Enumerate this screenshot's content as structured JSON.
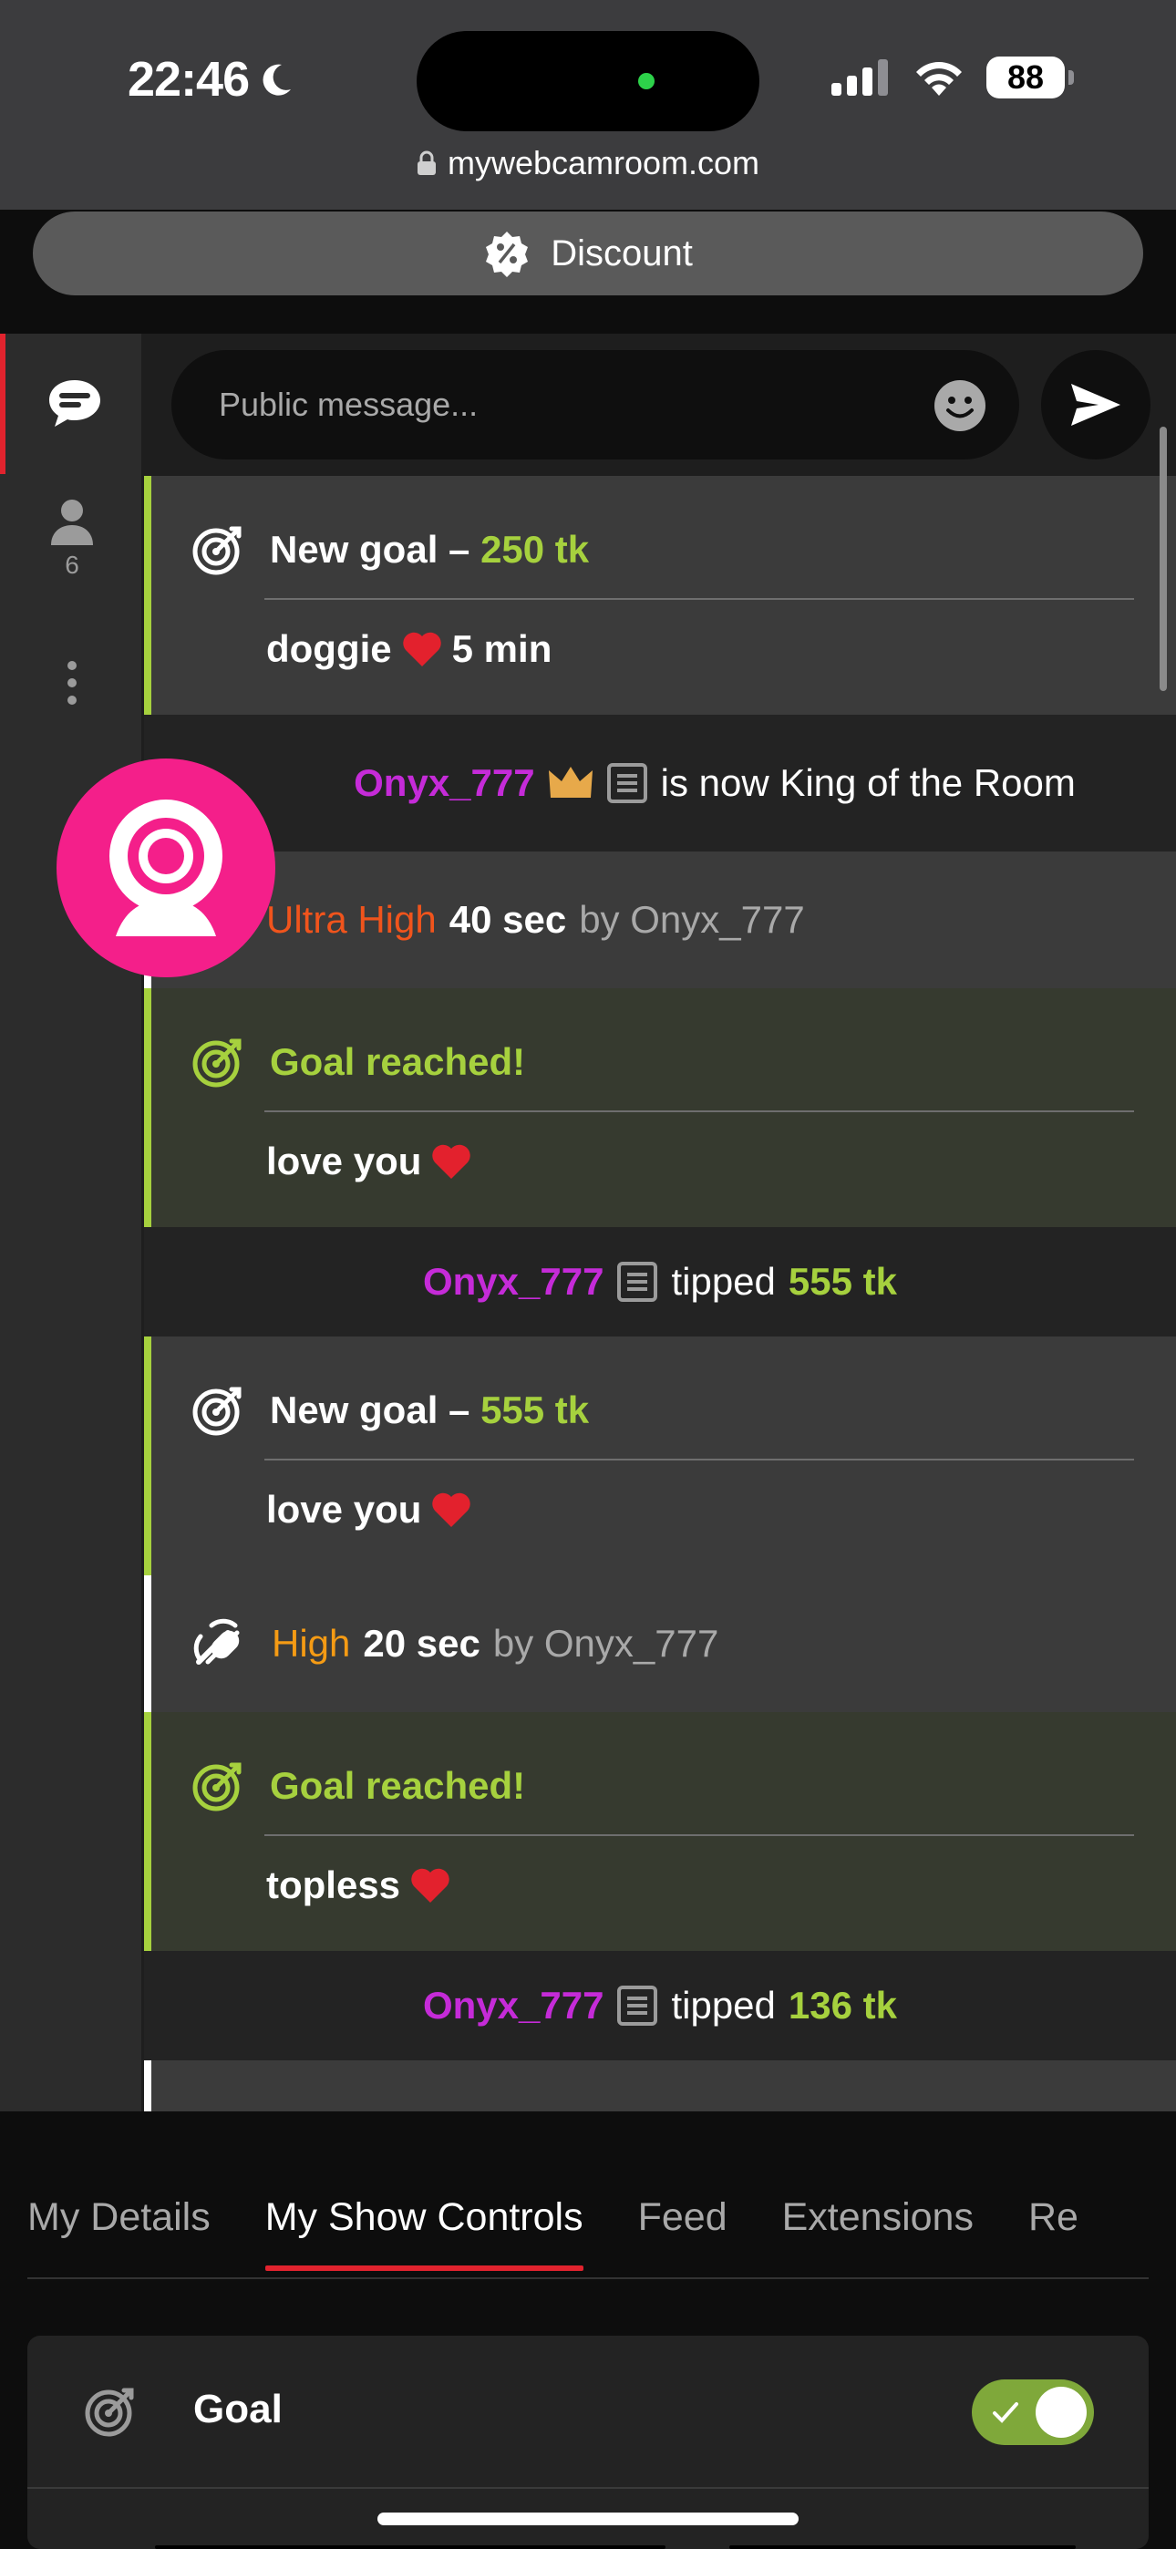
{
  "status_bar": {
    "time": "22:46",
    "battery": "88"
  },
  "browser": {
    "url": "mywebcamroom.com"
  },
  "discount": {
    "label": "Discount"
  },
  "sidebar": {
    "users_count": "6"
  },
  "composer": {
    "placeholder": "Public message..."
  },
  "messages": [
    {
      "type": "goal",
      "head_prefix": "New goal – ",
      "amount": "250 tk",
      "body": "doggie",
      "body_suffix": "5 min",
      "heart": true
    },
    {
      "type": "king",
      "user": "Onyx_777",
      "text": "is now King of the Room"
    },
    {
      "type": "effect",
      "level": "Ultra High",
      "level_color": "#f0541c",
      "duration": "40 sec",
      "by": "by Onyx_777"
    },
    {
      "type": "goal_reached",
      "head": "Goal reached!",
      "body": "love you",
      "heart": true
    },
    {
      "type": "tip",
      "user": "Onyx_777",
      "verb": "tipped",
      "amount": "555 tk"
    },
    {
      "type": "goal",
      "head_prefix": "New goal – ",
      "amount": "555 tk",
      "body": "love you",
      "heart": true
    },
    {
      "type": "effect",
      "level": "High",
      "level_color": "#f59b14",
      "duration": "20 sec",
      "by": "by Onyx_777"
    },
    {
      "type": "goal_reached",
      "head": "Goal reached!",
      "body": "topless",
      "heart": true
    },
    {
      "type": "tip",
      "user": "Onyx_777",
      "verb": "tipped",
      "amount": "136 tk"
    }
  ],
  "tabs": [
    "My Details",
    "My Show Controls",
    "Feed",
    "Extensions",
    "Re"
  ],
  "active_tab": "My Show Controls",
  "controls": {
    "goal_label": "Goal",
    "goal_enabled": true
  },
  "colors": {
    "accent_red": "#e1232e",
    "goal_green": "#a6d13e",
    "username_purple": "#c52bd8",
    "fab_pink": "#f41f8a"
  }
}
